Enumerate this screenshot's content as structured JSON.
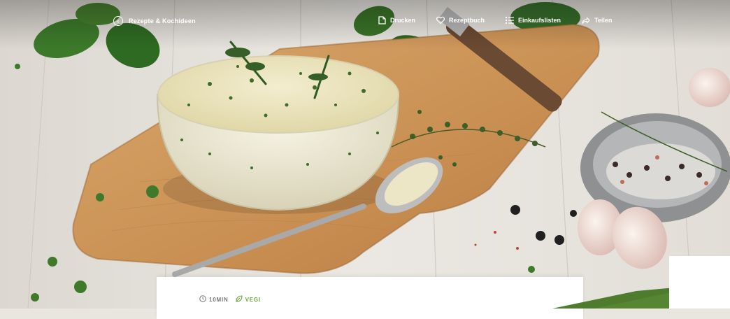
{
  "nav": {
    "back_label": "Rezepte & Kochideen",
    "actions": [
      {
        "label": "Drucken",
        "icon": "print-icon"
      },
      {
        "label": "Rezeptbuch",
        "icon": "heart-icon"
      },
      {
        "label": "Einkaufslisten",
        "icon": "list-icon"
      },
      {
        "label": "Teilen",
        "icon": "share-icon"
      }
    ]
  },
  "recipe": {
    "time": "10MIN",
    "tag": "VEGI"
  },
  "colors": {
    "accent_green": "#6aa83c",
    "banner_green": "#4e7b2d"
  }
}
